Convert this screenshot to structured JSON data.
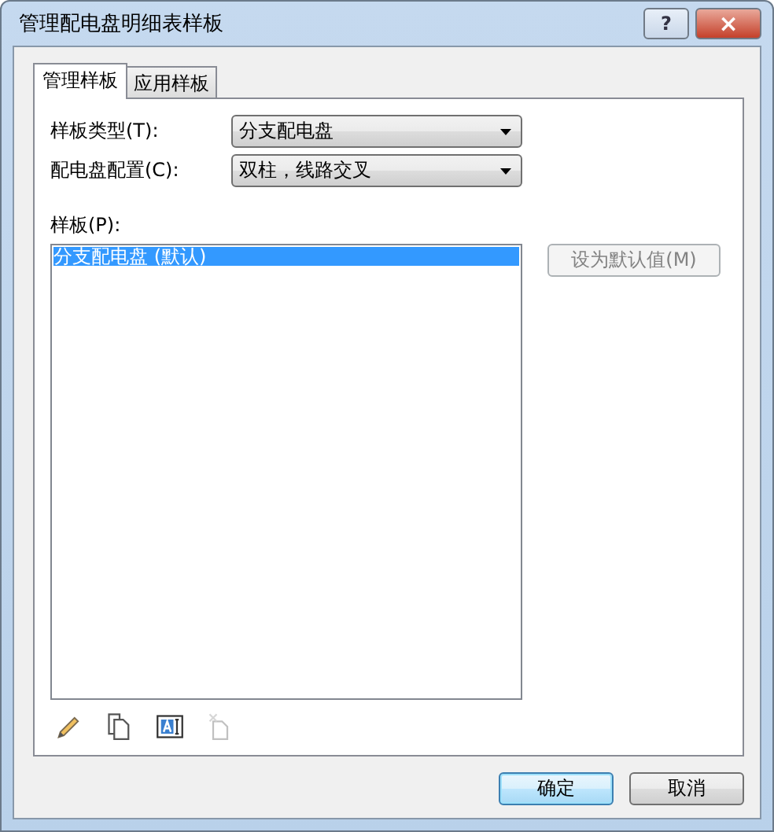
{
  "window": {
    "title": "管理配电盘明细表样板",
    "help": "?",
    "close": "×"
  },
  "tabs": [
    {
      "label": "管理样板",
      "selected": true
    },
    {
      "label": "应用样板",
      "selected": false
    }
  ],
  "fields": [
    {
      "label": "样板类型(T):",
      "value": "分支配电盘"
    },
    {
      "label": "配电盘配置(C):",
      "value": "双柱，线路交叉"
    }
  ],
  "list": {
    "label": "样板(P):",
    "items": [
      {
        "text": "分支配电盘 (默认)",
        "selected": true
      }
    ]
  },
  "set_default": {
    "label": "设为默认值(M)",
    "disabled": true
  },
  "tools": [
    {
      "kind": "edit",
      "disabled": false
    },
    {
      "kind": "copy",
      "disabled": false
    },
    {
      "kind": "rename",
      "disabled": false
    },
    {
      "kind": "delete",
      "disabled": true
    }
  ],
  "buttons": [
    {
      "label": "确定",
      "default": true
    },
    {
      "label": "取消",
      "default": false
    }
  ]
}
